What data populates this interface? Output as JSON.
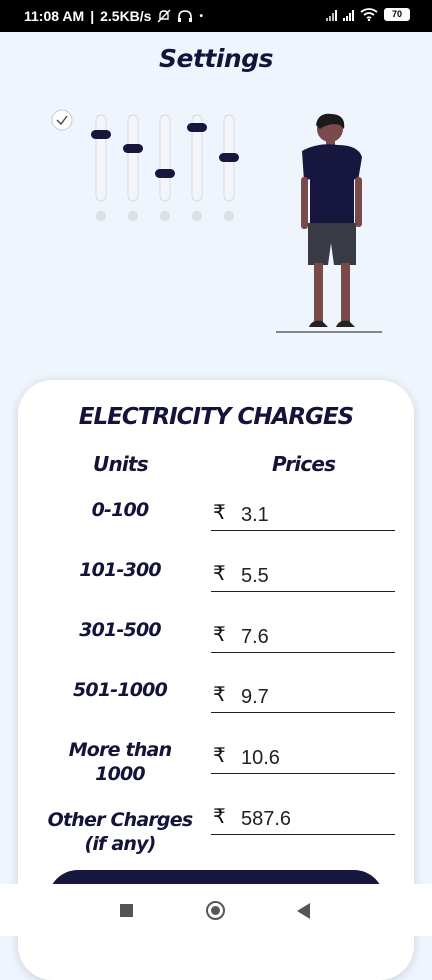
{
  "status_bar": {
    "time": "11:08 AM",
    "speed": "2.5KB/s",
    "battery": "70"
  },
  "title": "Settings",
  "card": {
    "heading": "ELECTRICITY CHARGES",
    "col_units": "Units",
    "col_prices": "Prices",
    "currency": "₹",
    "rows": [
      {
        "units": "0-100",
        "price": "3.1"
      },
      {
        "units": "101-300",
        "price": "5.5"
      },
      {
        "units": "301-500",
        "price": "7.6"
      },
      {
        "units": "501-1000",
        "price": "9.7"
      },
      {
        "units_line1": "More than",
        "units_line2": "1000",
        "price": "10.6"
      },
      {
        "units_line1": "Other Charges",
        "units_line2": "(if any)",
        "price": "587.6"
      }
    ]
  },
  "colors": {
    "background": "#eef5fc",
    "primary": "#17163f",
    "card": "#ffffff"
  }
}
